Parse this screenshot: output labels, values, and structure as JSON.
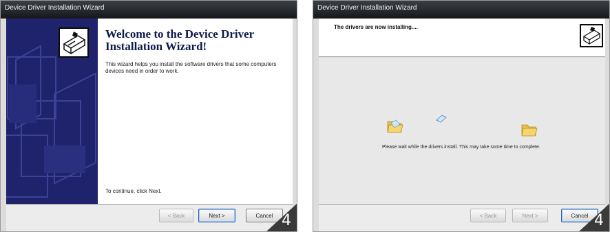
{
  "left_window": {
    "title": "Device Driver Installation Wizard",
    "heading": "Welcome to the Device Driver Installation Wizard!",
    "description": "This wizard helps you install the software drivers that some computers devices need in order to work.",
    "continue_text": "To continue, click Next.",
    "buttons": {
      "back_label": "< Back",
      "next_label": "Next >",
      "cancel_label": "Cancel"
    },
    "step_number": "4"
  },
  "right_window": {
    "title": "Device Driver Installation Wizard",
    "heading": "The drivers are now installing....",
    "wait_text": "Please wait while the drivers install. This may take some time to complete.",
    "buttons": {
      "back_label": "< Back",
      "next_label": "Next >",
      "cancel_label": "Cancel"
    },
    "step_number": "4"
  },
  "colors": {
    "sidebar_navy": "#1f236b",
    "step_badge": "#3a3a3a"
  },
  "icons": [
    "wizard-drive-icon",
    "folder-icon",
    "document-icon"
  ]
}
